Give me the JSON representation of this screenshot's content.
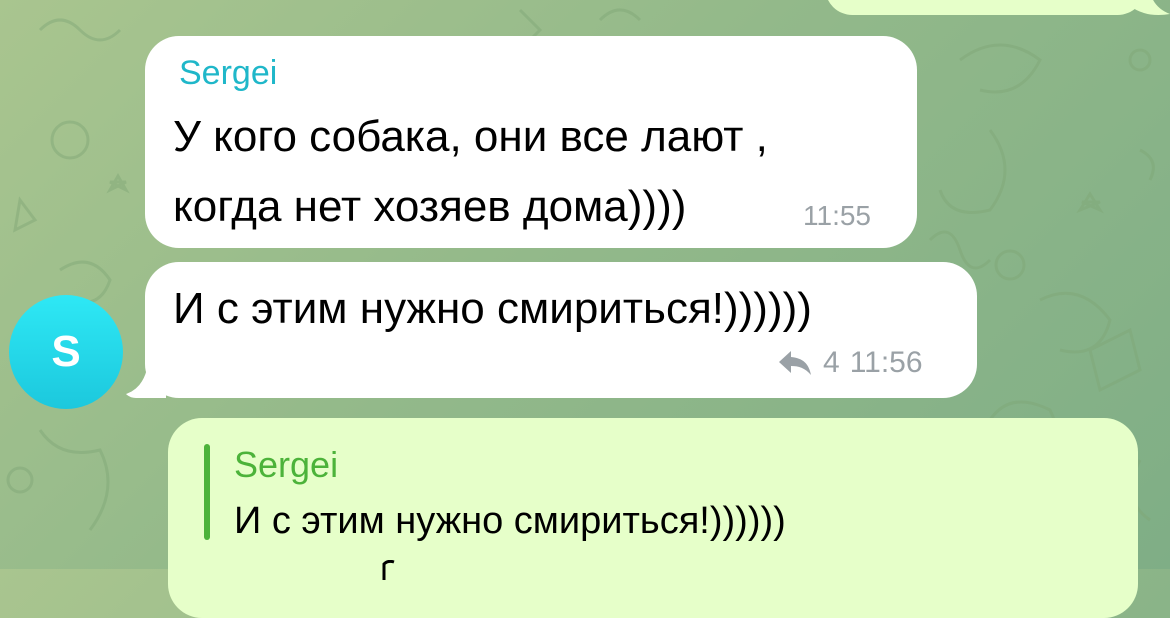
{
  "chat": {
    "previous_outgoing": {
      "visible": true
    },
    "incoming": {
      "sender": "Sergei",
      "avatar_letter": "S",
      "messages": [
        {
          "lines": [
            "У кого собака, они все лают ,",
            "когда нет хозяев дома))))"
          ],
          "time": "11:55"
        },
        {
          "text": "И с этим нужно смириться!))))))",
          "replies_count": "4",
          "time": "11:56"
        }
      ]
    },
    "outgoing_reply": {
      "quote_author": "Sergei",
      "quote_text": "И с этим нужно смириться!))))))"
    }
  },
  "colors": {
    "background": "#93b98a",
    "incoming_bubble": "#ffffff",
    "outgoing_bubble": "#e6ffc9",
    "sender_name": "#1fb7c9",
    "reply_accent": "#4cb33a",
    "avatar": "#1cc8dd",
    "meta_text": "#9aa1a6"
  },
  "icons": {
    "reply": "reply-arrow-icon"
  }
}
